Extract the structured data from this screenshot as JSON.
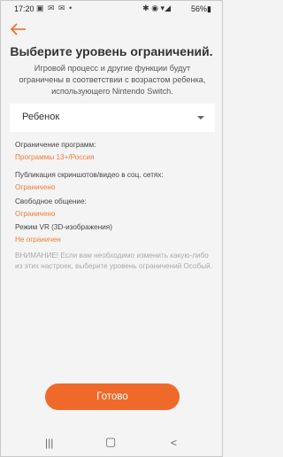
{
  "status": {
    "time": "17:20",
    "left_icons": "▣ ✉ ✉ •",
    "signal": "✱ ◉ ▾◢",
    "battery": "56%▮"
  },
  "title": "Выберите уровень ограничений.",
  "subtitle": "Игровой процесс и другие функции будут ограничены в соответствии с возрастом ребенка, использующего Nintendo Switch.",
  "select": {
    "value": "Ребенок"
  },
  "settings": [
    {
      "label": "Ограничение программ:",
      "value": "Программы 13+/Россия"
    },
    {
      "label": "Публикация скриншотов/видео в соц. сетях:",
      "value": "Ограничено"
    },
    {
      "label": "Свободное общение:",
      "value": "Ограничено"
    },
    {
      "label": "Режим VR (3D-изображения)",
      "value": "Не ограничен"
    }
  ],
  "warning": "ВНИМАНИЕ! Если вам необходимо изменить какую-либо из этих настроек, выберите уровень ограничений Особый.",
  "done_label": "Готово",
  "nav": {
    "recent": "|||",
    "home": "▢",
    "back": "<"
  },
  "colors": {
    "accent": "#ef6a2a",
    "value_text": "#f07a3a"
  }
}
